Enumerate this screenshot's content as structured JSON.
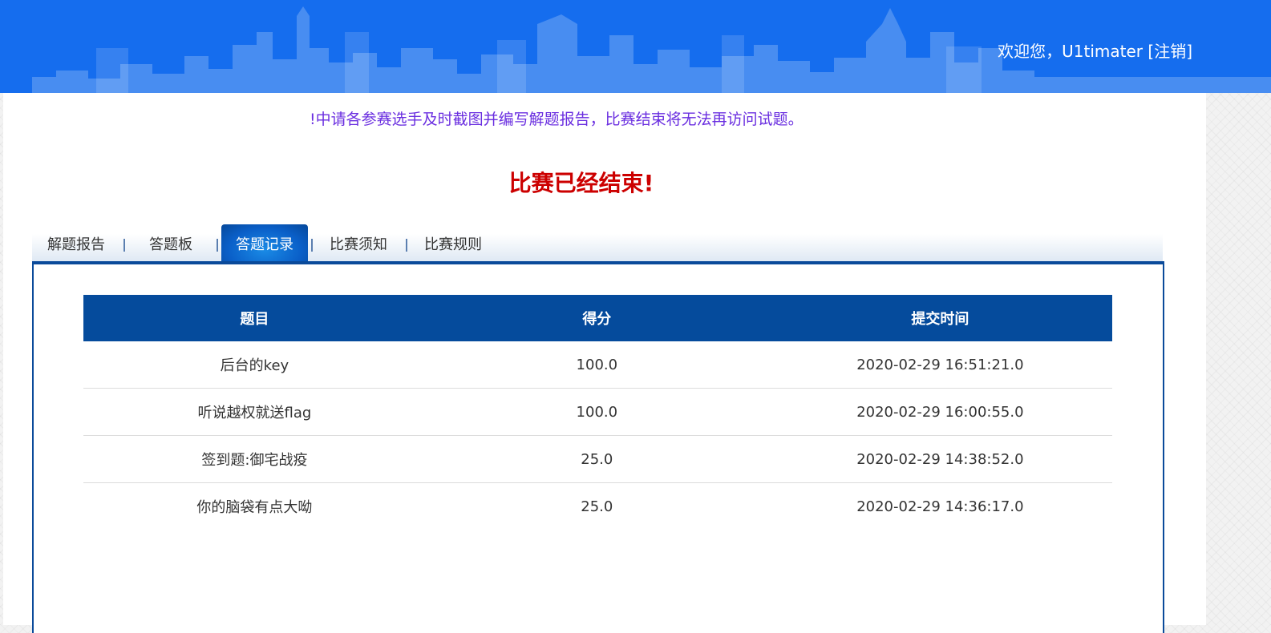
{
  "header": {
    "welcome_text": "欢迎您，U1timater",
    "logout_label": "[注销]"
  },
  "notice": "!中请各参赛选手及时截图并编写解题报告，比赛结束将无法再访问试题。",
  "status_message": "比赛已经结束!",
  "tabs": [
    {
      "label": "解题报告",
      "active": false
    },
    {
      "label": "答题板",
      "active": false
    },
    {
      "label": "答题记录",
      "active": true
    },
    {
      "label": "比赛须知",
      "active": false
    },
    {
      "label": "比赛规则",
      "active": false
    }
  ],
  "table": {
    "columns": [
      "题目",
      "得分",
      "提交时间"
    ],
    "rows": [
      {
        "title": "后台的key",
        "score": "100.0",
        "time": "2020-02-29 16:51:21.0"
      },
      {
        "title": "听说越权就送flag",
        "score": "100.0",
        "time": "2020-02-29 16:00:55.0"
      },
      {
        "title": "签到题:御宅战疫",
        "score": "25.0",
        "time": "2020-02-29 14:38:52.0"
      },
      {
        "title": "你的脑袋有点大呦",
        "score": "25.0",
        "time": "2020-02-29 14:36:17.0"
      }
    ]
  },
  "colors": {
    "header_blue": "#156dee",
    "table_header": "#054b9c",
    "notice_purple": "#6a2ee0",
    "status_red": "#cc0000"
  }
}
